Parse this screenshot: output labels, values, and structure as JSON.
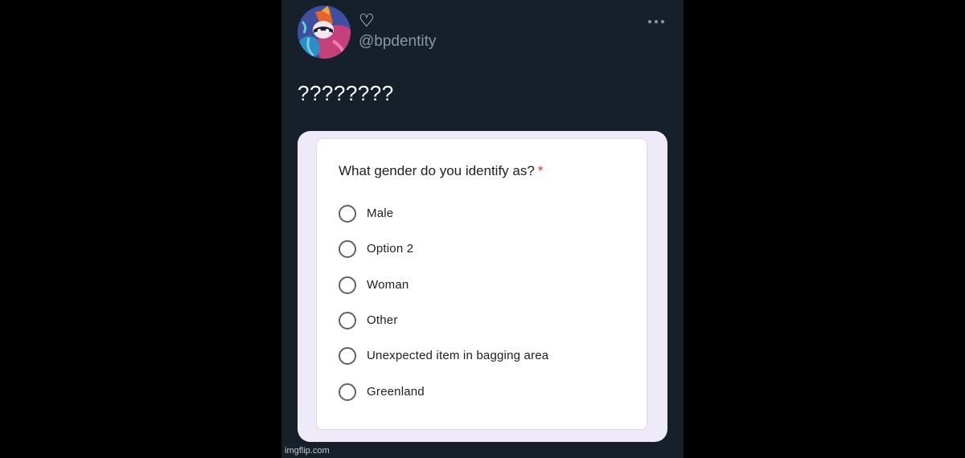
{
  "tweet": {
    "display_name": "♡",
    "handle": "@bpdentity",
    "text": "????????",
    "more_icon": "more-horizontal-icon",
    "avatar_icon": "avatar-illustration"
  },
  "form": {
    "question": "What gender do you identify as?",
    "required_marker": "*",
    "options": [
      {
        "label": "Male",
        "selected": false
      },
      {
        "label": "Option 2",
        "selected": false
      },
      {
        "label": "Woman",
        "selected": false
      },
      {
        "label": "Other",
        "selected": false
      },
      {
        "label": "Unexpected item in bagging area",
        "selected": false
      },
      {
        "label": "Greenland",
        "selected": false
      }
    ]
  },
  "watermark": "imgflip.com",
  "colors": {
    "page_background": "#000000",
    "tweet_background": "#15202b",
    "handle_text": "#8899a6",
    "media_frame": "#efeaf8",
    "required_star": "#d93025",
    "radio_border": "#5f6368"
  }
}
